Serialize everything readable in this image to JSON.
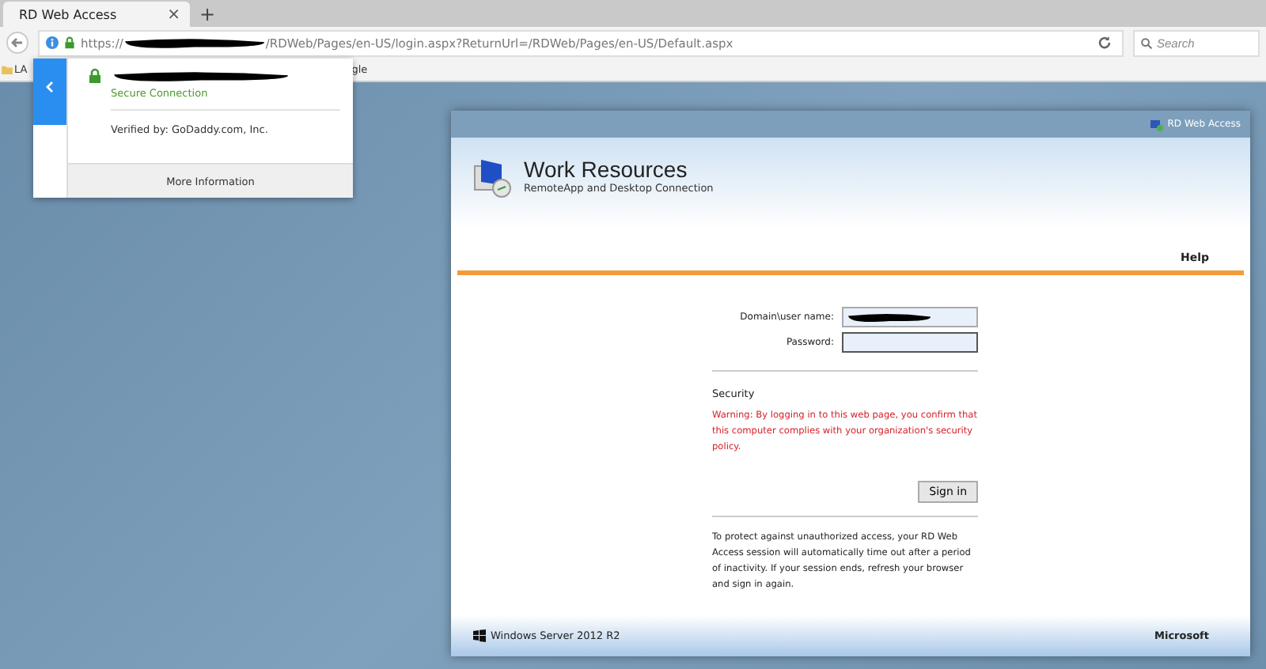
{
  "browser": {
    "tab": {
      "title": "RD Web Access",
      "close": "×",
      "selected": true
    },
    "new_tab": "+",
    "url": {
      "scheme": "https://",
      "path": "/RDWeb/Pages/en-US/login.aspx?ReturnUrl=/RDWeb/Pages/en-US/Default.aspx"
    },
    "search": {
      "placeholder": "Search"
    },
    "bookmarks": [
      {
        "label": "LA"
      },
      {
        "label": "gle"
      }
    ]
  },
  "site_popup": {
    "status": "Secure Connection",
    "verified": "Verified by: GoDaddy.com, Inc.",
    "button": "More Information"
  },
  "card": {
    "top_bar": "RD Web Access",
    "title": "Work Resources",
    "subtitle": "RemoteApp and Desktop Connection",
    "help": "Help",
    "fields": [
      {
        "label": "Domain\\user name:",
        "kind": "redacted",
        "focused": false
      },
      {
        "label": "Password:",
        "kind": "empty",
        "focused": true
      }
    ],
    "security_heading": "Security",
    "warning": "Warning: By logging in to this web page, you confirm that this computer complies with your organization's security policy.",
    "sign_in": "Sign in",
    "notice": "To protect against unauthorized access, your RD Web Access session will automatically time out after a period of inactivity. If your session ends, refresh your browser and sign in again.",
    "footer_left": "Windows Server 2012 R2",
    "footer_right": "Microsoft"
  }
}
